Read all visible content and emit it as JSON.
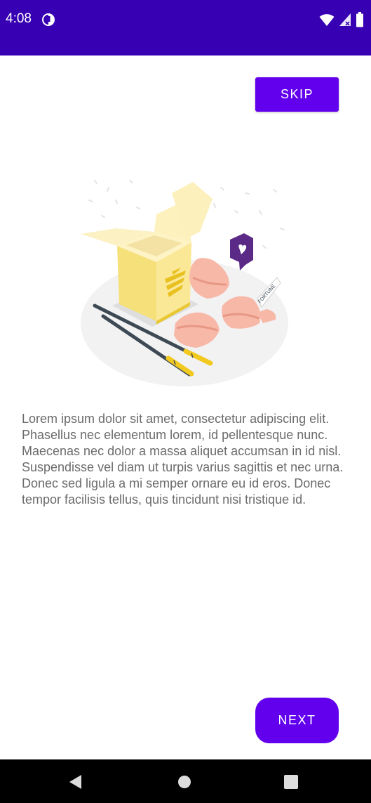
{
  "status_bar": {
    "time": "4:08",
    "background_color": "#3700b3",
    "icons": [
      "app-notification-icon",
      "wifi-icon",
      "signal-icon",
      "battery-icon"
    ]
  },
  "onboarding": {
    "skip_label": "SKIP",
    "next_label": "NEXT",
    "description": "Lorem ipsum dolor sit amet, consectetur adipiscing elit. Phasellus nec elementum lorem, id pellentesque nunc. Maecenas nec dolor a massa aliquet accumsan in id nisl. Suspendisse vel diam ut turpis varius sagittis et nec urna. Donec sed ligula a mi semper ornare eu id eros. Donec tempor facilisis tellus, quis tincidunt nisi tristique id.",
    "illustration": {
      "subject": "takeout-box-with-fortune-cookies-and-chopsticks",
      "fortune_text": "FORTUNE"
    },
    "accent_color": "#6200ee"
  },
  "nav_bar": {
    "buttons": [
      "back-icon",
      "home-icon",
      "recents-icon"
    ]
  }
}
